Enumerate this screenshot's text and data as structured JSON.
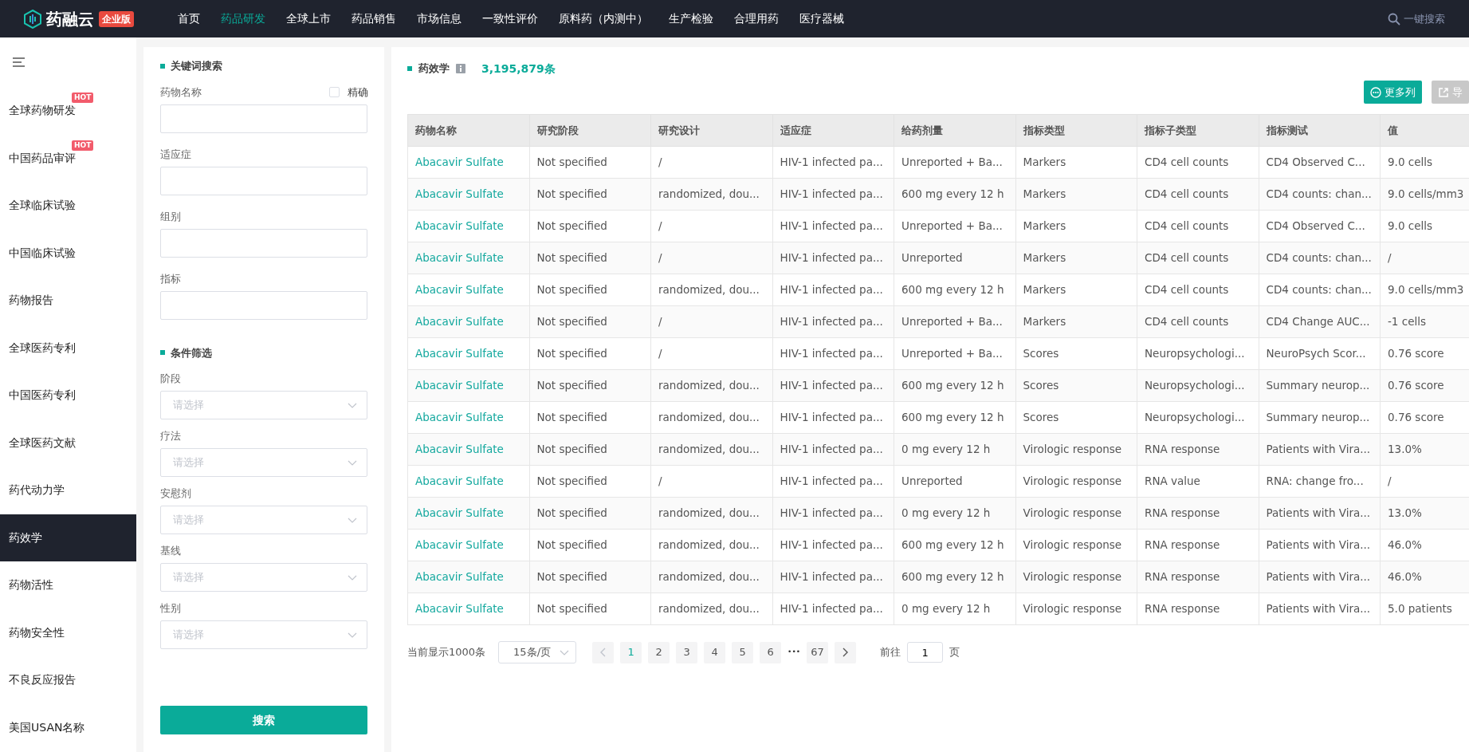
{
  "navbar": {
    "logo_text": "药融云",
    "edition_badge": "企业版",
    "items": [
      {
        "label": "首页",
        "selected": false
      },
      {
        "label": "药品研发",
        "selected": true
      },
      {
        "label": "全球上市",
        "selected": false
      },
      {
        "label": "药品销售",
        "selected": false
      },
      {
        "label": "市场信息",
        "selected": false
      },
      {
        "label": "一致性评价",
        "selected": false
      },
      {
        "label": "原料药（内测中）",
        "selected": false
      },
      {
        "label": "生产检验",
        "selected": false
      },
      {
        "label": "合理用药",
        "selected": false
      },
      {
        "label": "医疗器械",
        "selected": false
      }
    ],
    "search_label": "一键搜索"
  },
  "sidebar": {
    "items": [
      {
        "label": "全球药物研发",
        "selected": false,
        "badge": "HOT"
      },
      {
        "label": "中国药品审评",
        "selected": false,
        "badge": "HOT"
      },
      {
        "label": "全球临床试验",
        "selected": false
      },
      {
        "label": "中国临床试验",
        "selected": false
      },
      {
        "label": "药物报告",
        "selected": false
      },
      {
        "label": "全球医药专利",
        "selected": false
      },
      {
        "label": "中国医药专利",
        "selected": false
      },
      {
        "label": "全球医药文献",
        "selected": false
      },
      {
        "label": "药代动力学",
        "selected": false
      },
      {
        "label": "药效学",
        "selected": true
      },
      {
        "label": "药物活性",
        "selected": false
      },
      {
        "label": "药物安全性",
        "selected": false
      },
      {
        "label": "不良反应报告",
        "selected": false
      },
      {
        "label": "美国USAN名称",
        "selected": false
      }
    ]
  },
  "filters": {
    "keyword_title": "关键词搜索",
    "text_fields": [
      {
        "label": "药物名称",
        "option": {
          "label": "精确",
          "checked": false
        }
      },
      {
        "label": "适应症"
      },
      {
        "label": "组别"
      },
      {
        "label": "指标"
      }
    ],
    "condition_title": "条件筛选",
    "select_fields": [
      {
        "label": "阶段",
        "placeholder": "请选择"
      },
      {
        "label": "疗法",
        "placeholder": "请选择"
      },
      {
        "label": "安慰剂",
        "placeholder": "请选择"
      },
      {
        "label": "基线",
        "placeholder": "请选择"
      },
      {
        "label": "性别",
        "placeholder": "请选择"
      }
    ],
    "search_button": "搜索"
  },
  "results": {
    "title": "药效学",
    "count": "3,195,879条",
    "buttons": [
      {
        "label": "更多列",
        "kind": "more",
        "disabled": false
      },
      {
        "label": "导",
        "kind": "export",
        "disabled": true
      }
    ],
    "table": {
      "columns": [
        "药物名称",
        "研究阶段",
        "研究设计",
        "适应症",
        "给药剂量",
        "指标类型",
        "指标子类型",
        "指标测试",
        "值"
      ],
      "rows": [
        [
          "Abacavir Sulfate",
          "Not specified",
          "/",
          "HIV-1 infected pa...",
          "Unreported + Ba...",
          "Markers",
          "CD4 cell counts",
          "CD4 Observed C...",
          "9.0 cells"
        ],
        [
          "Abacavir Sulfate",
          "Not specified",
          "randomized, dou...",
          "HIV-1 infected pa...",
          "600 mg every 12 h",
          "Markers",
          "CD4 cell counts",
          "CD4 counts: chan...",
          "9.0 cells/mm3"
        ],
        [
          "Abacavir Sulfate",
          "Not specified",
          "/",
          "HIV-1 infected pa...",
          "Unreported + Ba...",
          "Markers",
          "CD4 cell counts",
          "CD4 Observed C...",
          "9.0 cells"
        ],
        [
          "Abacavir Sulfate",
          "Not specified",
          "/",
          "HIV-1 infected pa...",
          "Unreported",
          "Markers",
          "CD4 cell counts",
          "CD4 counts: chan...",
          "/"
        ],
        [
          "Abacavir Sulfate",
          "Not specified",
          "randomized, dou...",
          "HIV-1 infected pa...",
          "600 mg every 12 h",
          "Markers",
          "CD4 cell counts",
          "CD4 counts: chan...",
          "9.0 cells/mm3"
        ],
        [
          "Abacavir Sulfate",
          "Not specified",
          "/",
          "HIV-1 infected pa...",
          "Unreported + Ba...",
          "Markers",
          "CD4 cell counts",
          "CD4 Change AUC...",
          "-1 cells"
        ],
        [
          "Abacavir Sulfate",
          "Not specified",
          "/",
          "HIV-1 infected pa...",
          "Unreported + Ba...",
          "Scores",
          "Neuropsychologi...",
          "NeuroPsych Scor...",
          "0.76 score"
        ],
        [
          "Abacavir Sulfate",
          "Not specified",
          "randomized, dou...",
          "HIV-1 infected pa...",
          "600 mg every 12 h",
          "Scores",
          "Neuropsychologi...",
          "Summary neurop...",
          "0.76 score"
        ],
        [
          "Abacavir Sulfate",
          "Not specified",
          "randomized, dou...",
          "HIV-1 infected pa...",
          "600 mg every 12 h",
          "Scores",
          "Neuropsychologi...",
          "Summary neurop...",
          "0.76 score"
        ],
        [
          "Abacavir Sulfate",
          "Not specified",
          "randomized, dou...",
          "HIV-1 infected pa...",
          "0 mg every 12 h",
          "Virologic response",
          "RNA response",
          "Patients with Vira...",
          "13.0%"
        ],
        [
          "Abacavir Sulfate",
          "Not specified",
          "/",
          "HIV-1 infected pa...",
          "Unreported",
          "Virologic response",
          "RNA value",
          "RNA: change fro...",
          "/"
        ],
        [
          "Abacavir Sulfate",
          "Not specified",
          "randomized, dou...",
          "HIV-1 infected pa...",
          "0 mg every 12 h",
          "Virologic response",
          "RNA response",
          "Patients with Vira...",
          "13.0%"
        ],
        [
          "Abacavir Sulfate",
          "Not specified",
          "randomized, dou...",
          "HIV-1 infected pa...",
          "600 mg every 12 h",
          "Virologic response",
          "RNA response",
          "Patients with Vira...",
          "46.0%"
        ],
        [
          "Abacavir Sulfate",
          "Not specified",
          "randomized, dou...",
          "HIV-1 infected pa...",
          "600 mg every 12 h",
          "Virologic response",
          "RNA response",
          "Patients with Vira...",
          "46.0%"
        ],
        [
          "Abacavir Sulfate",
          "Not specified",
          "randomized, dou...",
          "HIV-1 infected pa...",
          "0 mg every 12 h",
          "Virologic response",
          "RNA response",
          "Patients with Vira...",
          "5.0 patients"
        ]
      ]
    }
  },
  "pagination": {
    "summary": "当前显示1000条",
    "page_size": "15条/页",
    "pages": [
      {
        "label": "1",
        "selected": true
      },
      {
        "label": "2",
        "selected": false
      },
      {
        "label": "3",
        "selected": false
      },
      {
        "label": "4",
        "selected": false
      },
      {
        "label": "5",
        "selected": false
      },
      {
        "label": "6",
        "selected": false
      }
    ],
    "ellipsis": "•••",
    "last_page": "67",
    "goto_label": "前往",
    "goto_value": "1",
    "goto_suffix": "页"
  }
}
